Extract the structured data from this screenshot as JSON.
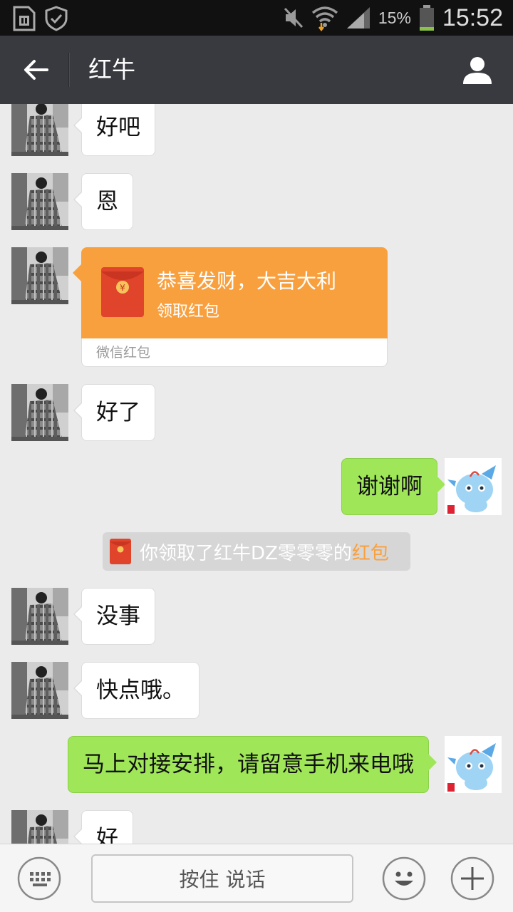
{
  "status_bar": {
    "battery_percent": "15%",
    "time": "15:52",
    "icons": [
      "sim-icon",
      "shield-icon",
      "mute-icon",
      "wifi-icon",
      "signal-icon",
      "battery-icon"
    ]
  },
  "header": {
    "title": "红牛",
    "icons": [
      "back-arrow-icon",
      "profile-icon"
    ]
  },
  "messages": [
    {
      "side": "in",
      "text": "好吧"
    },
    {
      "side": "in",
      "text": "恩"
    },
    {
      "side": "in",
      "type": "red_packet",
      "title": "恭喜发财，大吉大利",
      "action": "领取红包",
      "footer": "微信红包"
    },
    {
      "side": "in",
      "text": "好了"
    },
    {
      "side": "out",
      "text": "谢谢啊"
    },
    {
      "type": "system",
      "text": "你领取了红牛DZ零零零的",
      "link": "红包"
    },
    {
      "side": "in",
      "text": "没事"
    },
    {
      "side": "in",
      "text": "快点哦。"
    },
    {
      "side": "out",
      "text": "马上对接安排，请留意手机来电哦"
    },
    {
      "side": "in",
      "text": "好"
    }
  ],
  "input_bar": {
    "voice_label": "按住 说话",
    "icons": [
      "keyboard-icon",
      "emoji-icon",
      "plus-icon"
    ]
  },
  "colors": {
    "outgoing_bubble": "#9fe658",
    "red_packet": "#f9a03e",
    "header_bg": "#393a3f",
    "chat_bg": "#ebebeb"
  }
}
